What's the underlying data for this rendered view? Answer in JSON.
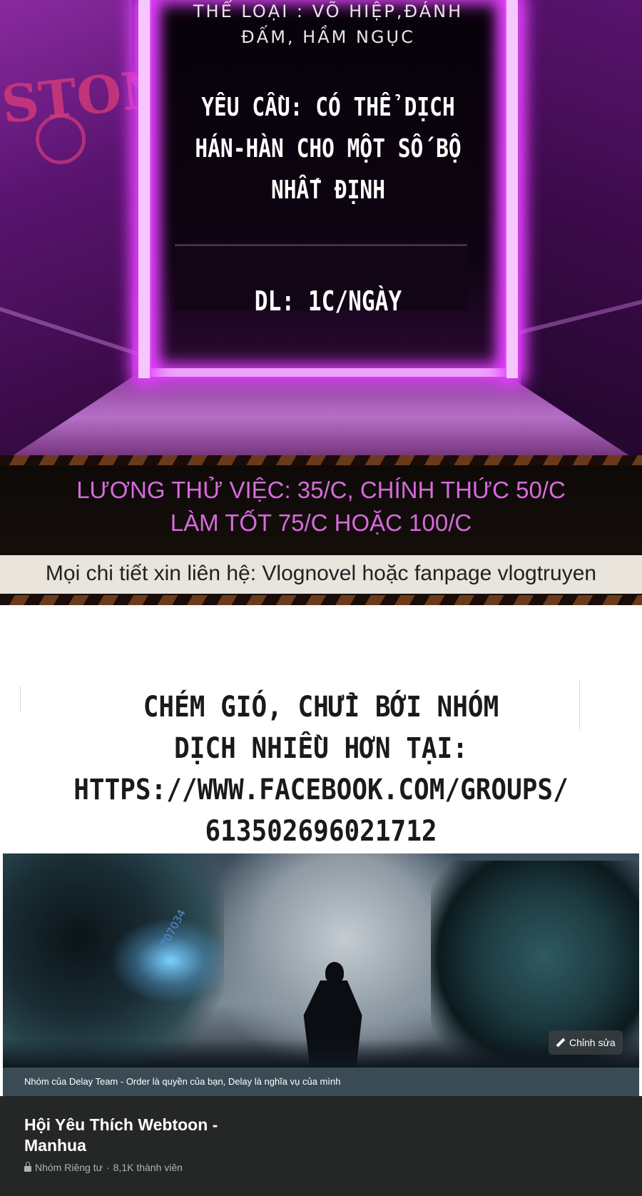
{
  "poster": {
    "genre_lines": [
      "THỂ LOẠI : VÕ HIỆP,ĐÁNH",
      "ĐẤM, HẦM NGỤC"
    ],
    "requirement_lines": [
      "YÊU CẦU: CÓ THỂ DỊCH",
      "HÁN-HÀN CHO MỘT SỐ BỘ",
      "NHẤT ĐỊNH"
    ],
    "deadline": "DL: 1C/NGÀY",
    "salary_lines": [
      "LƯƠNG THỬ VIỆC: 35/C, CHÍNH THỨC 50/C",
      "LÀM TỐT 75/C HOẶC 100/C"
    ],
    "contact": "Mọi chi tiết xin liên hệ: Vlognovel hoặc fanpage vlogtruyen",
    "graffiti": "STON",
    "colors": {
      "neon": "#e040fb",
      "salary_text": "#d66bdb"
    }
  },
  "caption": {
    "lines": [
      "CHÉM GIÓ, CHỬI BỚI NHÓM",
      "DỊCH NHIỀU HƠN TẠI:",
      "HTTPS://WWW.FACEBOOK.COM/GROUPS/",
      "613502696021712"
    ]
  },
  "group": {
    "cover_watermark": "707034",
    "edit_button_label": "Chỉnh sửa",
    "description": "Nhóm của Delay Team - Order là quyền của bạn, Delay là nghĩa vụ của mình",
    "name_lines": [
      "Hội Yêu Thích Webtoon -",
      "Manhua"
    ],
    "privacy": "Nhóm Riêng tư",
    "separator": "·",
    "members": "8,1K thành viên",
    "icons": {
      "edit": "pencil-icon",
      "privacy": "lock-icon"
    }
  }
}
